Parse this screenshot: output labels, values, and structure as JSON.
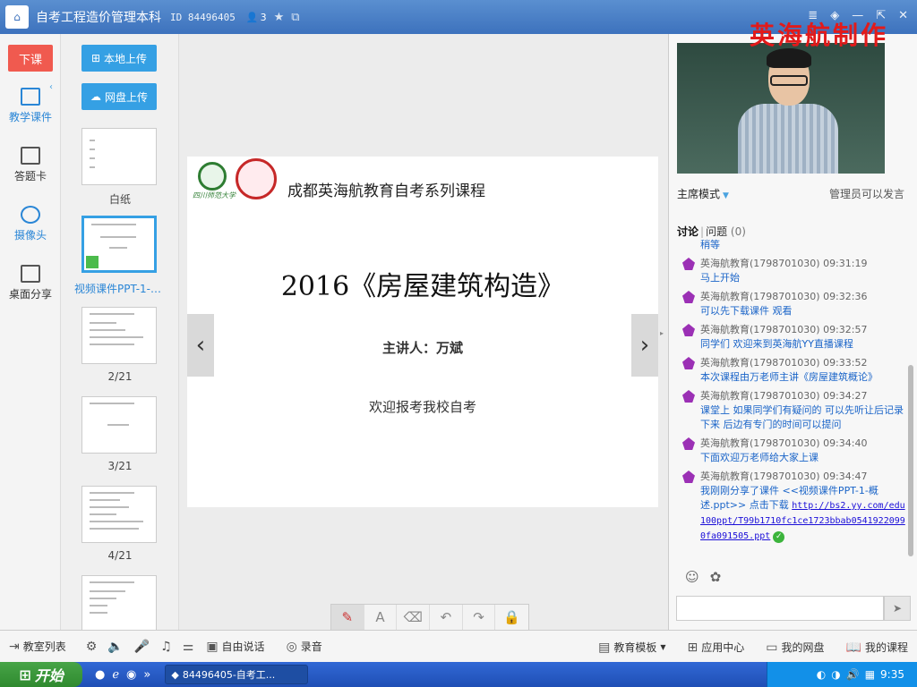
{
  "window": {
    "title": "自考工程造价管理本科",
    "id": "ID 84496405",
    "user_count": "3",
    "watermark": "英海航制作"
  },
  "leftnav": {
    "end_class": "下课",
    "items": [
      {
        "label": "教学课件",
        "active": true
      },
      {
        "label": "答题卡"
      },
      {
        "label": "摄像头"
      },
      {
        "label": "桌面分享"
      }
    ]
  },
  "thumbs": {
    "upload_local": "本地上传",
    "upload_cloud": "网盘上传",
    "items": [
      {
        "label": "白纸"
      },
      {
        "label": "视频课件PPT-1-…",
        "active": true
      },
      {
        "label": "2/21"
      },
      {
        "label": "3/21"
      },
      {
        "label": "4/21"
      }
    ]
  },
  "slide": {
    "logo_text": "四川师范大学",
    "header": "成都英海航教育自考系列课程",
    "title": "2016《房屋建筑构造》",
    "speaker": "主讲人：万斌",
    "welcome": "欢迎报考我校自考"
  },
  "right": {
    "mode": "主席模式",
    "admin_note": "管理员可以发言",
    "tab_discuss": "讨论",
    "tab_question": "问题",
    "question_count": "(0)",
    "messages": [
      {
        "who": "",
        "text": "稍等"
      },
      {
        "who": "英海航教育(1798701030) 09:31:19",
        "text": "马上开始"
      },
      {
        "who": "英海航教育(1798701030) 09:32:36",
        "text": "可以先下载课件 观看"
      },
      {
        "who": "英海航教育(1798701030) 09:32:57",
        "text": "同学们 欢迎来到英海航YY直播课程"
      },
      {
        "who": "英海航教育(1798701030) 09:33:52",
        "text": "本次课程由万老师主讲《房屋建筑概论》"
      },
      {
        "who": "英海航教育(1798701030) 09:34:27",
        "text": "课堂上 如果同学们有疑问的 可以先听让后记录下来 后边有专门的时间可以提问"
      },
      {
        "who": "英海航教育(1798701030) 09:34:40",
        "text": "下面欢迎万老师给大家上课"
      },
      {
        "who": "英海航教育(1798701030) 09:34:47",
        "text": "我刚刚分享了课件 <<视频课件PPT-1-概述.ppt>> 点击下载",
        "link": "http://bs2.yy.com/edu100ppt/T99b1710fc1ce1723bbab05419220990fa091505.ppt"
      }
    ]
  },
  "bottom": {
    "room_list": "教室列表",
    "free_talk": "自由说话",
    "record": "录音",
    "template": "教育模板",
    "app_center": "应用中心",
    "my_disk": "我的网盘",
    "my_course": "我的课程"
  },
  "taskbar": {
    "start": "开始",
    "task": "84496405-自考工...",
    "time": "9:35"
  },
  "colors": {
    "titlebar": "#3d72bd",
    "accent": "#35a0e4",
    "end_button": "#f05a4f",
    "chat_text": "#1a64c8"
  }
}
